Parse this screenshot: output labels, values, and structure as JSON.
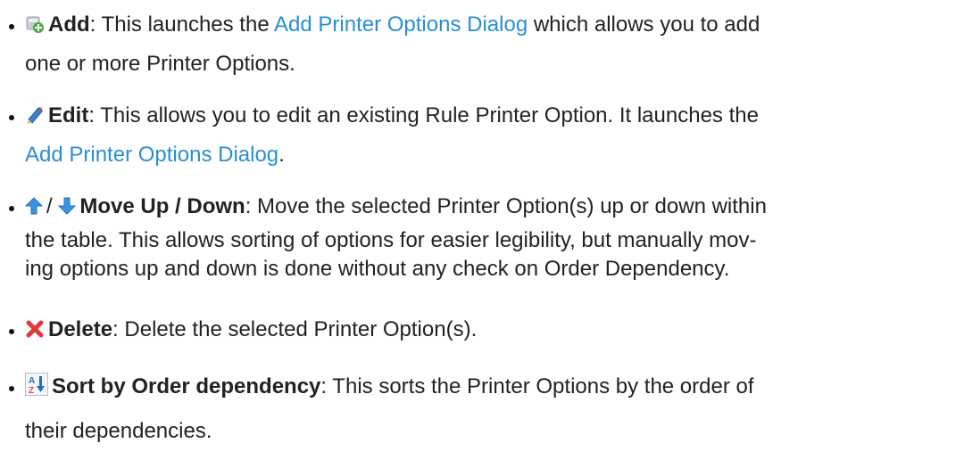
{
  "items": [
    {
      "icon": "add-printer-icon",
      "label": "Add",
      "text_before_link": ": This launches the ",
      "link": "Add Printer Options Dialog",
      "text_after_link": " which allows you to add",
      "line2": "one or more Printer Options."
    },
    {
      "icon": "pencil-edit-icon",
      "label": "Edit",
      "text": ": This allows you to edit an existing Rule Printer Option. It launches the",
      "link": "Add Printer Options Dialog",
      "link_suffix": "."
    },
    {
      "icon_up": "arrow-up-icon",
      "separator": "/",
      "icon_down": "arrow-down-icon",
      "label": "Move Up / Down",
      "text": ": Move the selected Printer Option(s) up or down within",
      "line2": "the table. This allows sorting of options for easier legibility, but manually mov-",
      "line3": "ing options up and down is done without any check on Order Dependency."
    },
    {
      "icon": "red-x-delete-icon",
      "label": "Delete",
      "text": ": Delete the selected Printer Option(s)."
    },
    {
      "icon": "sort-az-icon",
      "label": "Sort by Order dependency",
      "text": ": This sorts the Printer Options by the order of",
      "line2": "their dependencies."
    }
  ],
  "colors": {
    "link": "#2a8fd0",
    "text": "#222222"
  }
}
